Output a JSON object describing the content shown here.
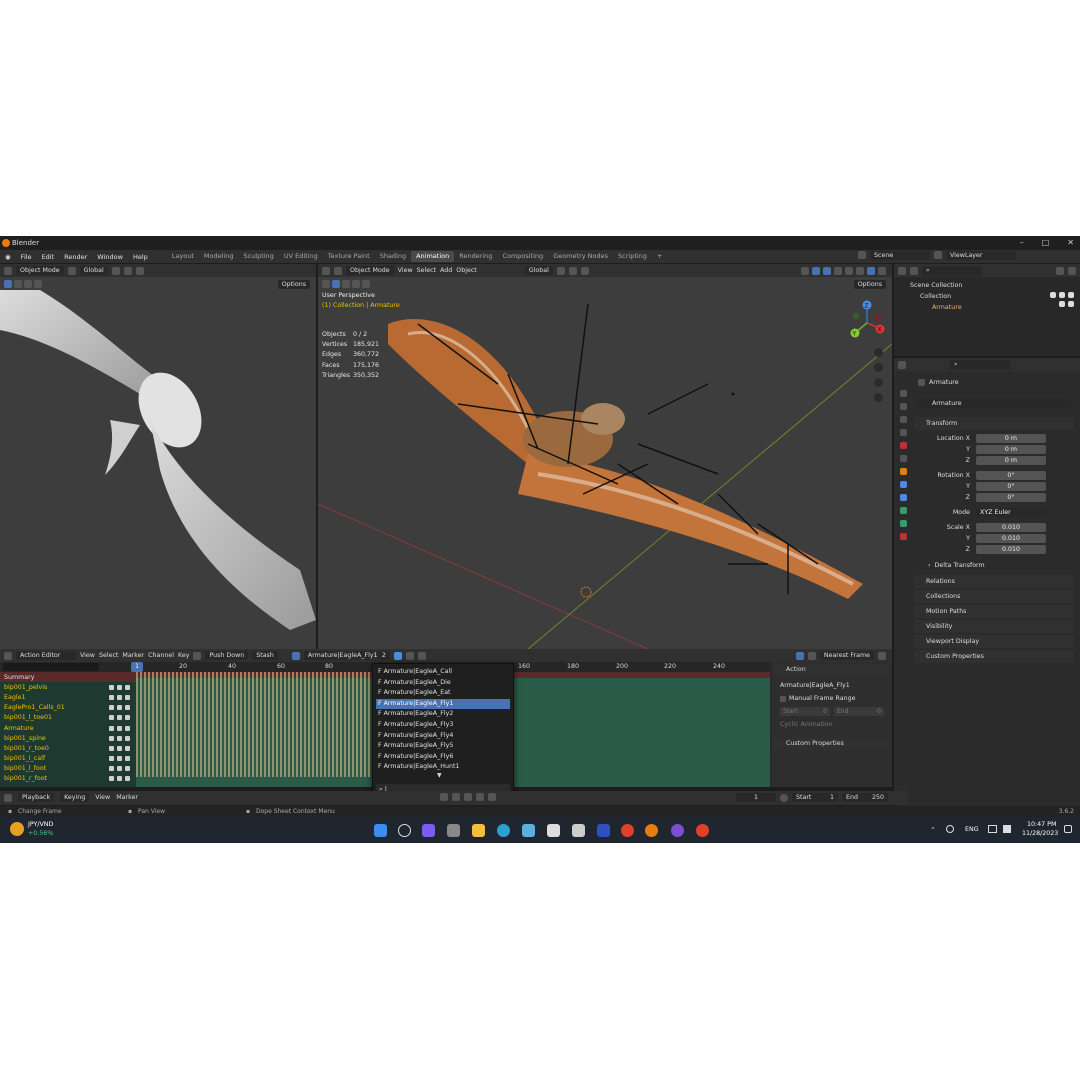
{
  "window": {
    "title": "Blender",
    "version": "3.6.2"
  },
  "menu": [
    "File",
    "Edit",
    "Render",
    "Window",
    "Help"
  ],
  "workspaces": [
    "Layout",
    "Modeling",
    "Sculpting",
    "UV Editing",
    "Texture Paint",
    "Shading",
    "Animation",
    "Rendering",
    "Compositing",
    "Geometry Nodes",
    "Scripting"
  ],
  "active_workspace": "Animation",
  "scene": {
    "name": "Scene",
    "view_layer": "ViewLayer"
  },
  "left_viewport": {
    "mode": "Object Mode",
    "orientation": "Global",
    "options": "Options"
  },
  "main_viewport": {
    "mode": "Object Mode",
    "menus": [
      "View",
      "Select",
      "Add",
      "Object"
    ],
    "orientation": "Global",
    "options": "Options",
    "perspective": "User Perspective",
    "context": "(1) Collection | Armature",
    "stats": [
      {
        "k": "Objects",
        "v": "0 / 2"
      },
      {
        "k": "Vertices",
        "v": "185,921"
      },
      {
        "k": "Edges",
        "v": "360,772"
      },
      {
        "k": "Faces",
        "v": "175,176"
      },
      {
        "k": "Triangles",
        "v": "350,352"
      }
    ],
    "gizmo": {
      "x": "X",
      "y": "Y",
      "z": "Z"
    }
  },
  "outliner": {
    "rows": [
      "Scene Collection",
      "Collection",
      "Armature"
    ]
  },
  "properties": {
    "object_name": "Armature",
    "data_name": "Armature",
    "transform_label": "Transform",
    "location": {
      "label": "Location X",
      "x": "0 m",
      "y": "0 m",
      "z": "0 m"
    },
    "rotation": {
      "label": "Rotation X",
      "x": "0°",
      "y": "0°",
      "z": "0°"
    },
    "mode": {
      "label": "Mode",
      "value": "XYZ Euler"
    },
    "scale": {
      "label": "Scale X",
      "x": "0.010",
      "y": "0.010",
      "z": "0.010"
    },
    "axis_y": "Y",
    "axis_z": "Z",
    "delta": "Delta Transform",
    "sections": [
      "Relations",
      "Collections",
      "Motion Paths",
      "Visibility",
      "Viewport Display",
      "Custom Properties"
    ]
  },
  "action_editor": {
    "editor": "Action Editor",
    "menus": [
      "View",
      "Select",
      "Marker",
      "Channel",
      "Key"
    ],
    "push_down": "Push Down",
    "stash": "Stash",
    "action": "Armature|EagleA_Fly1",
    "users": "2",
    "snap": "Nearest Frame",
    "frame_ticks": [
      "1",
      "20",
      "40",
      "60",
      "80",
      "160",
      "180",
      "200",
      "220",
      "240"
    ],
    "channels": [
      "Summary",
      "bip001_pelvis",
      "Eagle1",
      "EaglePro1_Calls_01",
      "bip001_l_toe01",
      "Armature",
      "bip001_spine",
      "bip001_r_toe0",
      "bip001_l_calf",
      "bip001_l_foot",
      "bip001_r_foot"
    ],
    "dropdown": [
      "F Armature|EagleA_Call",
      "F Armature|EagleA_Die",
      "F Armature|EagleA_Eat",
      "F Armature|EagleA_Fly1",
      "F Armature|EagleA_Fly2",
      "F Armature|EagleA_Fly3",
      "F Armature|EagleA_Fly4",
      "F Armature|EagleA_Fly5",
      "F Armature|EagleA_Fly6",
      "F Armature|EagleA_Hunt1"
    ],
    "dropdown_selected": 3,
    "side": {
      "action_label": "Action",
      "action_name": "Armature|EagleA_Fly1",
      "manual_range": "Manual Frame Range",
      "start_label": "Start",
      "start_val": "0",
      "end_label": "End",
      "end_val": "0",
      "cyclic": "Cyclic Animation",
      "custom": "Custom Properties"
    }
  },
  "timeline": {
    "menus": [
      "Playback",
      "Keying",
      "View",
      "Marker"
    ],
    "current": "1",
    "start_label": "Start",
    "start": "1",
    "end_label": "End",
    "end": "250"
  },
  "status": {
    "left": "Change Frame",
    "mid": "Pan View",
    "right": "Dope Sheet Context Menu"
  },
  "taskbar": {
    "ticker": "JPY/VND",
    "change": "+0.56%",
    "lang": "ENG",
    "time": "10:47 PM",
    "date": "11/28/2023"
  },
  "colors": {
    "accent": "#4772b3",
    "active_orange": "#e87d0d",
    "channel_yellow": "#f0c000",
    "key_green": "#2a5a48"
  }
}
